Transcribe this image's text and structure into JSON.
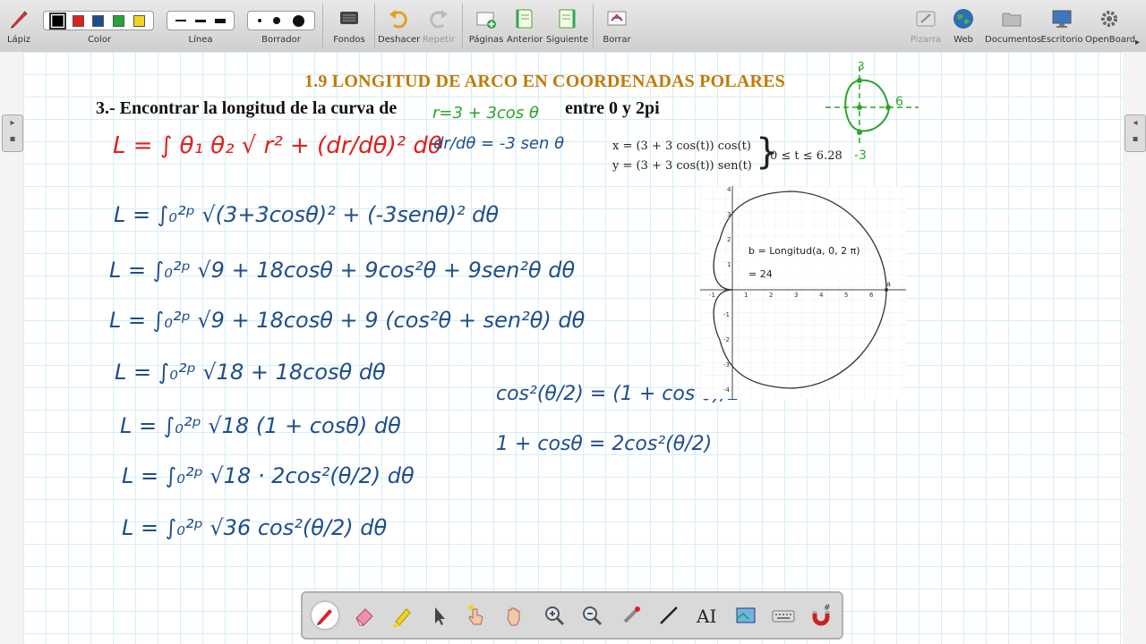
{
  "toolbar": {
    "items": [
      {
        "label": "Lápiz",
        "icon": "pencil-icon"
      },
      {
        "label": "Color",
        "icon": "color-palette"
      },
      {
        "label": "Línea",
        "icon": "line-width"
      },
      {
        "label": "Borrador",
        "icon": "eraser-size"
      },
      {
        "label": "Fondos",
        "icon": "background-icon"
      },
      {
        "label": "Deshacer",
        "icon": "undo-icon"
      },
      {
        "label": "Repetir",
        "icon": "redo-icon"
      },
      {
        "label": "Páginas",
        "icon": "add-page-icon"
      },
      {
        "label": "Anterior",
        "icon": "previous-page-icon"
      },
      {
        "label": "Siguiente",
        "icon": "next-page-icon"
      },
      {
        "label": "Borrar",
        "icon": "clear-page-icon"
      },
      {
        "label": "Pizarra",
        "icon": "board-icon"
      },
      {
        "label": "Web",
        "icon": "globe-icon"
      },
      {
        "label": "Documentos",
        "icon": "folder-icon"
      },
      {
        "label": "Escritorio",
        "icon": "desktop-icon"
      },
      {
        "label": "OpenBoard",
        "icon": "gear-icon"
      }
    ],
    "colors": [
      "#000000",
      "#e0201b",
      "#1f4e8c",
      "#23a638",
      "#f4d31e"
    ]
  },
  "content": {
    "title": "1.9 LONGITUD DE ARCO EN COORDENADAS POLARES",
    "problem_start": "3.- Encontrar la longitud de la curva de",
    "problem_end": "entre 0 y 2pi",
    "param_x": "x = (3 + 3 cos(t)) cos(t)",
    "param_y": "y = (3 + 3 cos(t)) sen(t)",
    "param_range": "0 ≤ t ≤ 6.28",
    "graph_label": "b = Longitud(a, 0, 2 π)",
    "graph_value": "= 24",
    "graph_point": "a"
  },
  "handwriting": {
    "curve": "r=3 + 3cos θ",
    "formula": "L = ∫ θ₁ θ₂ √ r² + (dr/dθ)²  dθ",
    "derivative": "dr/dθ = -3 sen θ",
    "step1": "L = ∫₀²ᵖ √(3+3cosθ)² + (-3senθ)²  dθ",
    "step2": "L = ∫₀²ᵖ √9 + 18cosθ + 9cos²θ + 9sen²θ  dθ",
    "step3": "L = ∫₀²ᵖ √9 + 18cosθ + 9 (cos²θ + sen²θ)  dθ",
    "step4": "L = ∫₀²ᵖ √18 + 18cosθ  dθ",
    "step5": "L = ∫₀²ᵖ √18 (1 + cosθ)  dθ",
    "step6": "L = ∫₀²ᵖ √18 · 2cos²(θ/2)  dθ",
    "step7": "L = ∫₀²ᵖ √36 cos²(θ/2)  dθ",
    "identity1": "cos²(θ/2) = (1 + cos θ)/2",
    "identity2": "1 + cosθ = 2cos²(θ/2)",
    "sketch_labels": [
      "3",
      "6",
      "-3"
    ]
  }
}
